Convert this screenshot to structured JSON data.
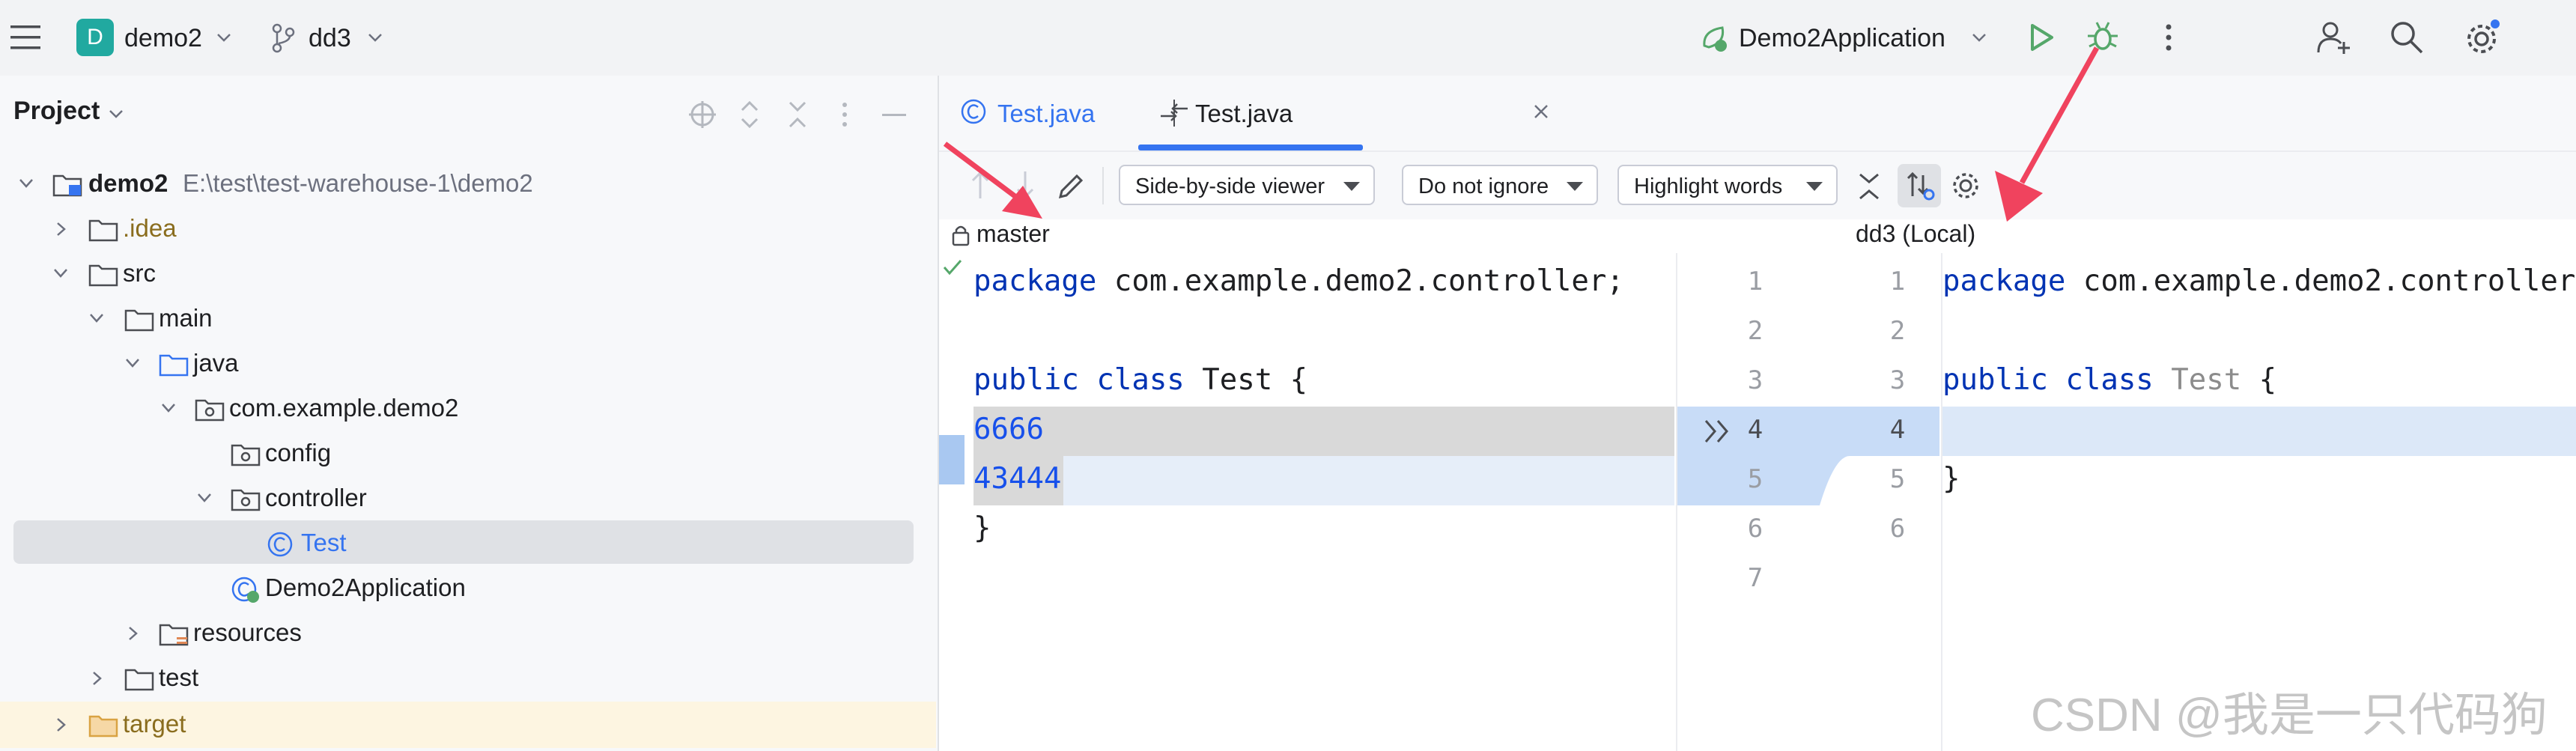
{
  "topbar": {
    "project_initial": "D",
    "project_name": "demo2",
    "branch": "dd3",
    "run_config": "Demo2Application"
  },
  "sidebar": {
    "title": "Project",
    "tree": [
      {
        "label": "demo2",
        "path": "E:\\test\\test-warehouse-1\\demo2",
        "kind": "module"
      },
      {
        "label": ".idea",
        "kind": "folder"
      },
      {
        "label": "src",
        "kind": "folder"
      },
      {
        "label": "main",
        "kind": "folder"
      },
      {
        "label": "java",
        "kind": "source-folder"
      },
      {
        "label": "com.example.demo2",
        "kind": "package"
      },
      {
        "label": "config",
        "kind": "package"
      },
      {
        "label": "controller",
        "kind": "package"
      },
      {
        "label": "Test",
        "kind": "class",
        "selected": true
      },
      {
        "label": "Demo2Application",
        "kind": "spring-class"
      },
      {
        "label": "resources",
        "kind": "resource-folder"
      },
      {
        "label": "test",
        "kind": "folder"
      },
      {
        "label": "target",
        "kind": "folder"
      }
    ]
  },
  "tabs": [
    {
      "label": "Test.java",
      "active": false
    },
    {
      "label": "Test.java",
      "active": true
    }
  ],
  "diff_toolbar": {
    "viewer": "Side-by-side viewer",
    "ignore": "Do not ignore",
    "highlight": "Highlight words"
  },
  "diff": {
    "left_title": "master",
    "right_title": "dd3 (Local)",
    "left_lines": [
      {
        "n": "1",
        "parts": [
          [
            "kw",
            "package"
          ],
          [
            "t",
            " com.example.demo2.controller;"
          ]
        ]
      },
      {
        "n": "2",
        "parts": []
      },
      {
        "n": "3",
        "parts": [
          [
            "kw",
            "public"
          ],
          [
            "t",
            " "
          ],
          [
            "kw",
            "class"
          ],
          [
            "t",
            " Test {"
          ]
        ]
      },
      {
        "n": "4",
        "parts": [
          [
            "num",
            "6666"
          ]
        ]
      },
      {
        "n": "5",
        "parts": [
          [
            "num",
            "43444"
          ]
        ]
      },
      {
        "n": "6",
        "parts": [
          [
            "t",
            "}"
          ]
        ]
      },
      {
        "n": "7",
        "parts": []
      }
    ],
    "right_lines": [
      {
        "n": "1",
        "parts": [
          [
            "kw",
            "package"
          ],
          [
            "t",
            " com.example.demo2.controller"
          ]
        ]
      },
      {
        "n": "2",
        "parts": []
      },
      {
        "n": "3",
        "parts": [
          [
            "kw",
            "public"
          ],
          [
            "t",
            " "
          ],
          [
            "kw",
            "class"
          ],
          [
            "g",
            " Test"
          ],
          [
            "t",
            " {"
          ]
        ]
      },
      {
        "n": "4",
        "parts": []
      },
      {
        "n": "5",
        "parts": [
          [
            "t",
            "}"
          ]
        ]
      },
      {
        "n": "6",
        "parts": []
      }
    ]
  },
  "watermark": "CSDN @我是一只代码狗",
  "colors": {
    "accent_blue": "#3574f0",
    "run_green": "#55a76a",
    "annotation_pink": "#f0435e",
    "diff_removed_gray": "#d9d9d9",
    "diff_changed_blue": "#c8dcf7",
    "selected_row": "#dfe1e5",
    "target_bg": "#fdf5e1"
  }
}
